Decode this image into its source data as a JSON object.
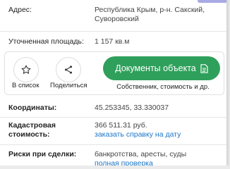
{
  "details": {
    "address": {
      "label": "Адрес:",
      "line1": "Республика Крым, р-н. Сакский,",
      "line2": "Суворовский"
    },
    "area": {
      "label": "Уточненная площадь:",
      "value": "1 157 кв.м"
    }
  },
  "actions": {
    "save_label": "В список",
    "share_label": "Поделиться",
    "docs_button_label": "Документы объекта",
    "docs_subtitle": "Собственник, стоимость и др."
  },
  "more": {
    "coords": {
      "label": "Координаты:",
      "value": "45.253345, 33.330037"
    },
    "cadastral": {
      "label_line1": "Кадастровая",
      "label_line2": "стоимость:",
      "value": "366 511.31 руб.",
      "link": "заказать справку на дату"
    },
    "risks": {
      "label": "Риски при сделки:",
      "value": "банкротства, аресты, суды",
      "link": "полная проверка"
    }
  },
  "colors": {
    "accent_green": "#2fa05b",
    "link_blue": "#1d76c8"
  },
  "icons": {
    "save": "star-icon",
    "share": "share-icon",
    "docs": "document-icon"
  }
}
